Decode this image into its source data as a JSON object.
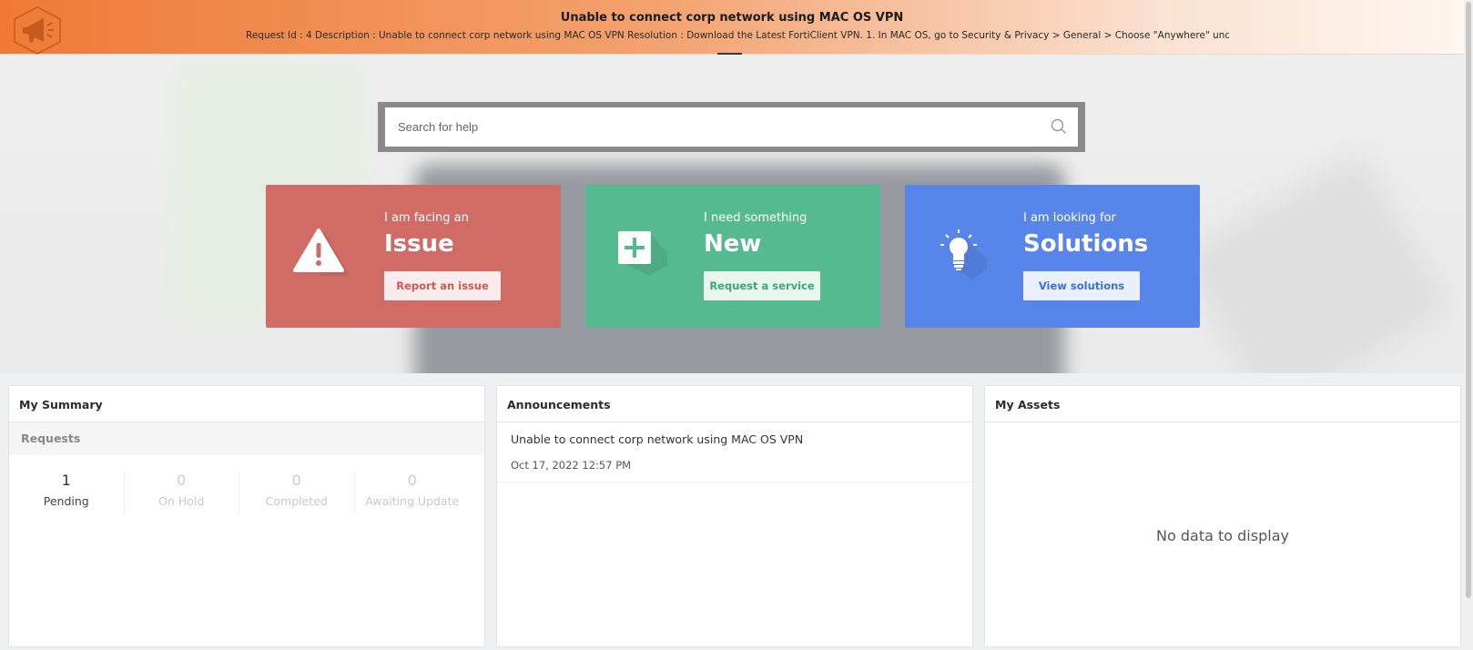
{
  "banner": {
    "title": "Unable to connect corp network using MAC OS VPN",
    "description": "Request Id : 4 Description : Unable to connect corp network using MAC OS VPN Resolution : Download the Latest FortiClient VPN. 1. In MAC OS, go to Security & Privacy > General > Choose \"Anywhere\" under \"Allow appli",
    "toggle_icon": "chevron-up-icon",
    "logo_icon": "megaphone-icon"
  },
  "search": {
    "placeholder": "Search for help",
    "icon": "search-icon"
  },
  "cards": {
    "issue": {
      "subtitle": "I am facing an",
      "title": "Issue",
      "button": "Report an issue",
      "icon": "warning-icon",
      "color": "#d16b66"
    },
    "new": {
      "subtitle": "I need something",
      "title": "New",
      "button": "Request a service",
      "icon": "plus-icon",
      "color": "#55ba8f"
    },
    "solutions": {
      "subtitle": "I am looking for",
      "title": "Solutions",
      "button": "View solutions",
      "icon": "lightbulb-icon",
      "color": "#5885ea"
    }
  },
  "summary": {
    "title": "My Summary",
    "section": "Requests",
    "stats": [
      {
        "value": "1",
        "label": "Pending"
      },
      {
        "value": "0",
        "label": "On Hold"
      },
      {
        "value": "0",
        "label": "Completed"
      },
      {
        "value": "0",
        "label": "Awaiting Update"
      }
    ]
  },
  "announcements": {
    "title": "Announcements",
    "items": [
      {
        "title": "Unable to connect corp network using MAC OS VPN",
        "date": "Oct 17, 2022 12:57 PM"
      }
    ]
  },
  "assets": {
    "title": "My Assets",
    "empty_text": "No data to display"
  },
  "colors": {
    "banner_accent": "#ef7a36"
  }
}
